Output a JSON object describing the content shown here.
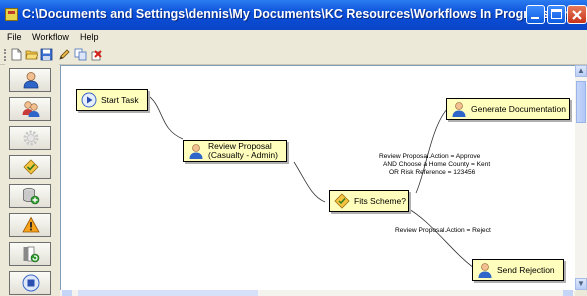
{
  "window": {
    "title": "C:\\Documents and Settings\\dennis\\My Documents\\KC Resources\\Workflows In Progress\\First Experim..."
  },
  "menu": {
    "items": [
      {
        "label": "File"
      },
      {
        "label": "Workflow"
      },
      {
        "label": "Help"
      }
    ]
  },
  "toolbar": {
    "tools": [
      "new-icon",
      "open-folder-icon",
      "save-icon",
      "pencil-icon",
      "copy-icon",
      "delete-icon"
    ]
  },
  "palette": {
    "items": [
      "user-task-icon",
      "group-task-icon",
      "gear-icon",
      "decision-icon",
      "database-add-icon",
      "warning-icon",
      "document-add-icon",
      "stop-icon"
    ]
  },
  "nodes": {
    "start": {
      "label": "Start Task"
    },
    "review": {
      "label": "Review Proposal",
      "sub": "(Casualty - Admin)"
    },
    "fits": {
      "label": "Fits Scheme?"
    },
    "generate": {
      "label": "Generate Documentation"
    },
    "reject": {
      "label": "Send Rejection"
    }
  },
  "conditions": {
    "approve": {
      "line1": "Review Proposal.Action = Approve",
      "line2": "AND Choose a Home County = Kent",
      "line3": "OR Risk Reference = 123456"
    },
    "reject": {
      "line1": "Review Proposal.Action = Reject"
    }
  },
  "colors": {
    "titlebar": "#0b4ed8",
    "node_fill": "#fffebc",
    "canvas": "#ffffff"
  }
}
